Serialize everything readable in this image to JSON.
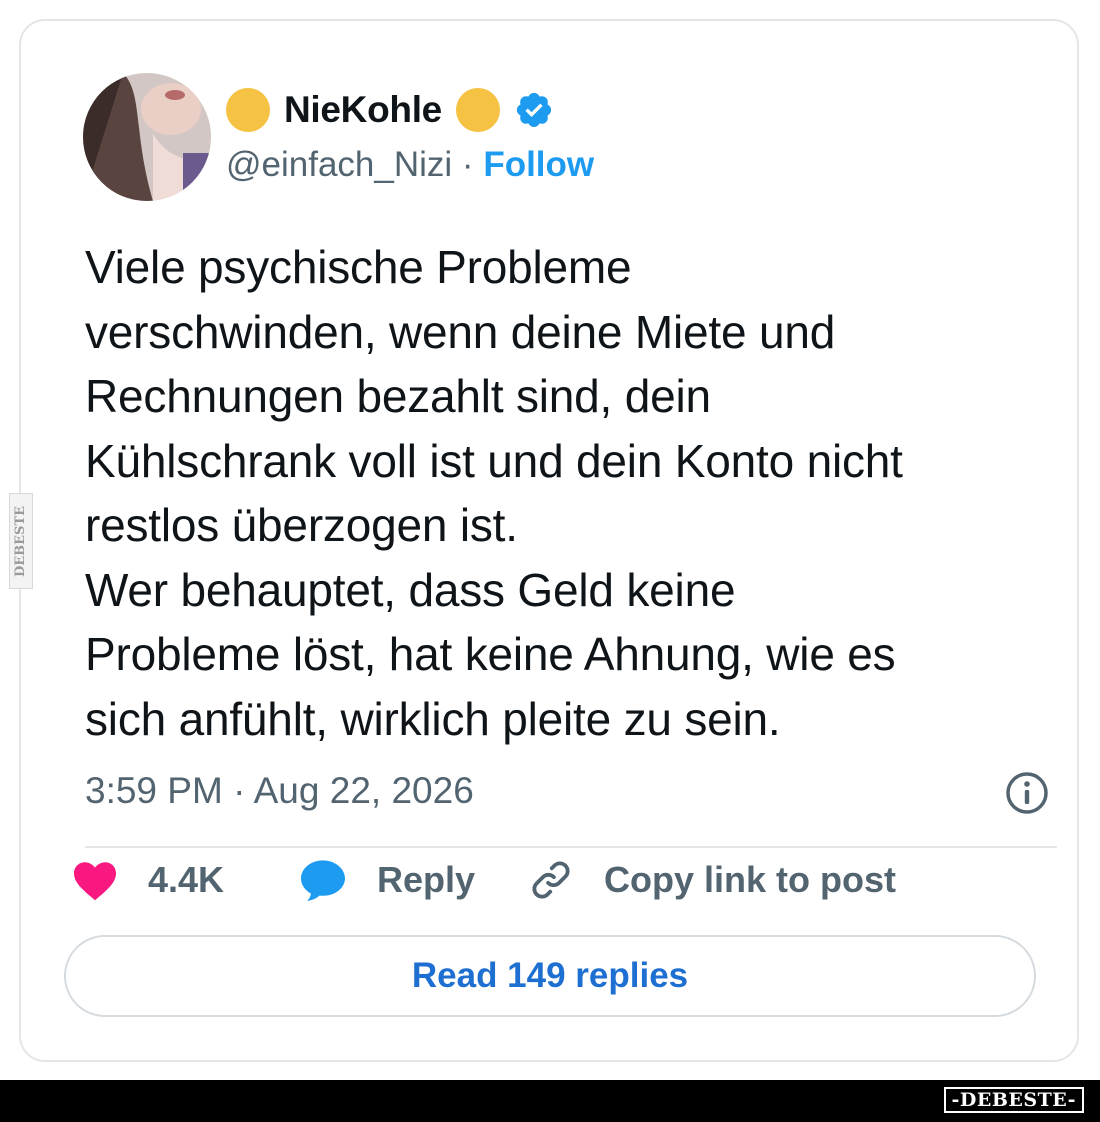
{
  "colors": {
    "text_primary": "#0f1419",
    "text_secondary": "#536471",
    "link_blue": "#1d9bf0",
    "verified_blue": "#1d9bf0",
    "heart_pink": "#f91880",
    "reply_blue": "#1d9bf0",
    "emoji_yellow": "#f6c243"
  },
  "author": {
    "display_name": "NieKohle",
    "handle": "@einfach_Nizi",
    "separator": "·",
    "follow_label": "Follow",
    "verified": true
  },
  "tweet": {
    "text": "Viele psychische Probleme\nverschwinden, wenn deine Miete und\nRechnungen bezahlt sind, dein\nKühlschrank voll ist und dein Konto nicht\nrestlos überzogen ist.\nWer behauptet, dass Geld keine\nProbleme löst, hat keine Ahnung, wie es\nsich anfühlt, wirklich pleite zu sein.",
    "timestamp": "3:59 PM · Aug 22, 2026"
  },
  "actions": {
    "like_count": "4.4K",
    "reply_label": "Reply",
    "copy_link_label": "Copy link to post"
  },
  "replies_button": {
    "label": "Read 149 replies"
  },
  "watermarks": {
    "side": "DEBESTE",
    "bottom": "-DEBESTE-"
  }
}
